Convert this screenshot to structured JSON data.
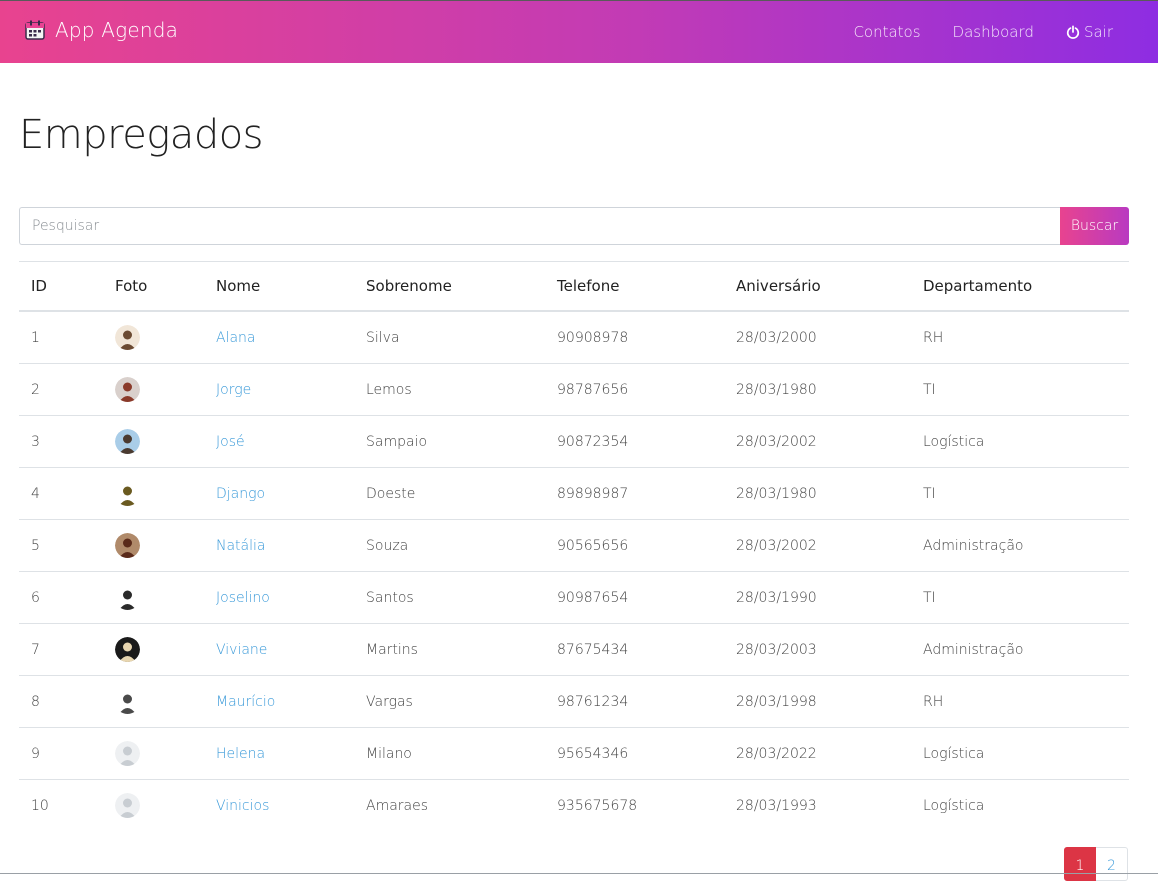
{
  "navbar": {
    "brand": "App Agenda",
    "links": [
      "Contatos",
      "Dashboard",
      "Sair"
    ],
    "icons": [
      "calendar-icon",
      "power-icon"
    ]
  },
  "page_title": "Empregados",
  "search": {
    "placeholder": "Pesquisar",
    "value": "",
    "button": "Buscar"
  },
  "table": {
    "headers": [
      "ID",
      "Foto",
      "Nome",
      "Sobrenome",
      "Telefone",
      "Aniversário",
      "Departamento"
    ],
    "rows": [
      {
        "id": "1",
        "nome": "Alana",
        "sobrenome": "Silva",
        "telefone": "90908978",
        "aniversario": "28/03/2000",
        "departamento": "RH"
      },
      {
        "id": "2",
        "nome": "Jorge",
        "sobrenome": "Lemos",
        "telefone": "98787656",
        "aniversario": "28/03/1980",
        "departamento": "TI"
      },
      {
        "id": "3",
        "nome": "José",
        "sobrenome": "Sampaio",
        "telefone": "90872354",
        "aniversario": "28/03/2002",
        "departamento": "Logística"
      },
      {
        "id": "4",
        "nome": "Django",
        "sobrenome": "Doeste",
        "telefone": "89898987",
        "aniversario": "28/03/1980",
        "departamento": "TI"
      },
      {
        "id": "5",
        "nome": "Natália",
        "sobrenome": "Souza",
        "telefone": "90565656",
        "aniversario": "28/03/2002",
        "departamento": "Administração"
      },
      {
        "id": "6",
        "nome": "Joselino",
        "sobrenome": "Santos",
        "telefone": "90987654",
        "aniversario": "28/03/1990",
        "departamento": "TI"
      },
      {
        "id": "7",
        "nome": "Viviane",
        "sobrenome": "Martins",
        "telefone": "87675434",
        "aniversario": "28/03/2003",
        "departamento": "Administração"
      },
      {
        "id": "8",
        "nome": "Maurício",
        "sobrenome": "Vargas",
        "telefone": "98761234",
        "aniversario": "28/03/1998",
        "departamento": "RH"
      },
      {
        "id": "9",
        "nome": "Helena",
        "sobrenome": "Milano",
        "telefone": "95654346",
        "aniversario": "28/03/2022",
        "departamento": "Logística"
      },
      {
        "id": "10",
        "nome": "Vinicios",
        "sobrenome": "Amaraes",
        "telefone": "935675678",
        "aniversario": "28/03/1993",
        "departamento": "Logística"
      }
    ]
  },
  "pagination": {
    "pages": [
      "1",
      "2"
    ],
    "current": "1"
  },
  "colors": {
    "accent_start": "#e8438f",
    "accent_end": "#8e2de2",
    "link": "#3a9ad9",
    "active_page": "#dc3545"
  }
}
